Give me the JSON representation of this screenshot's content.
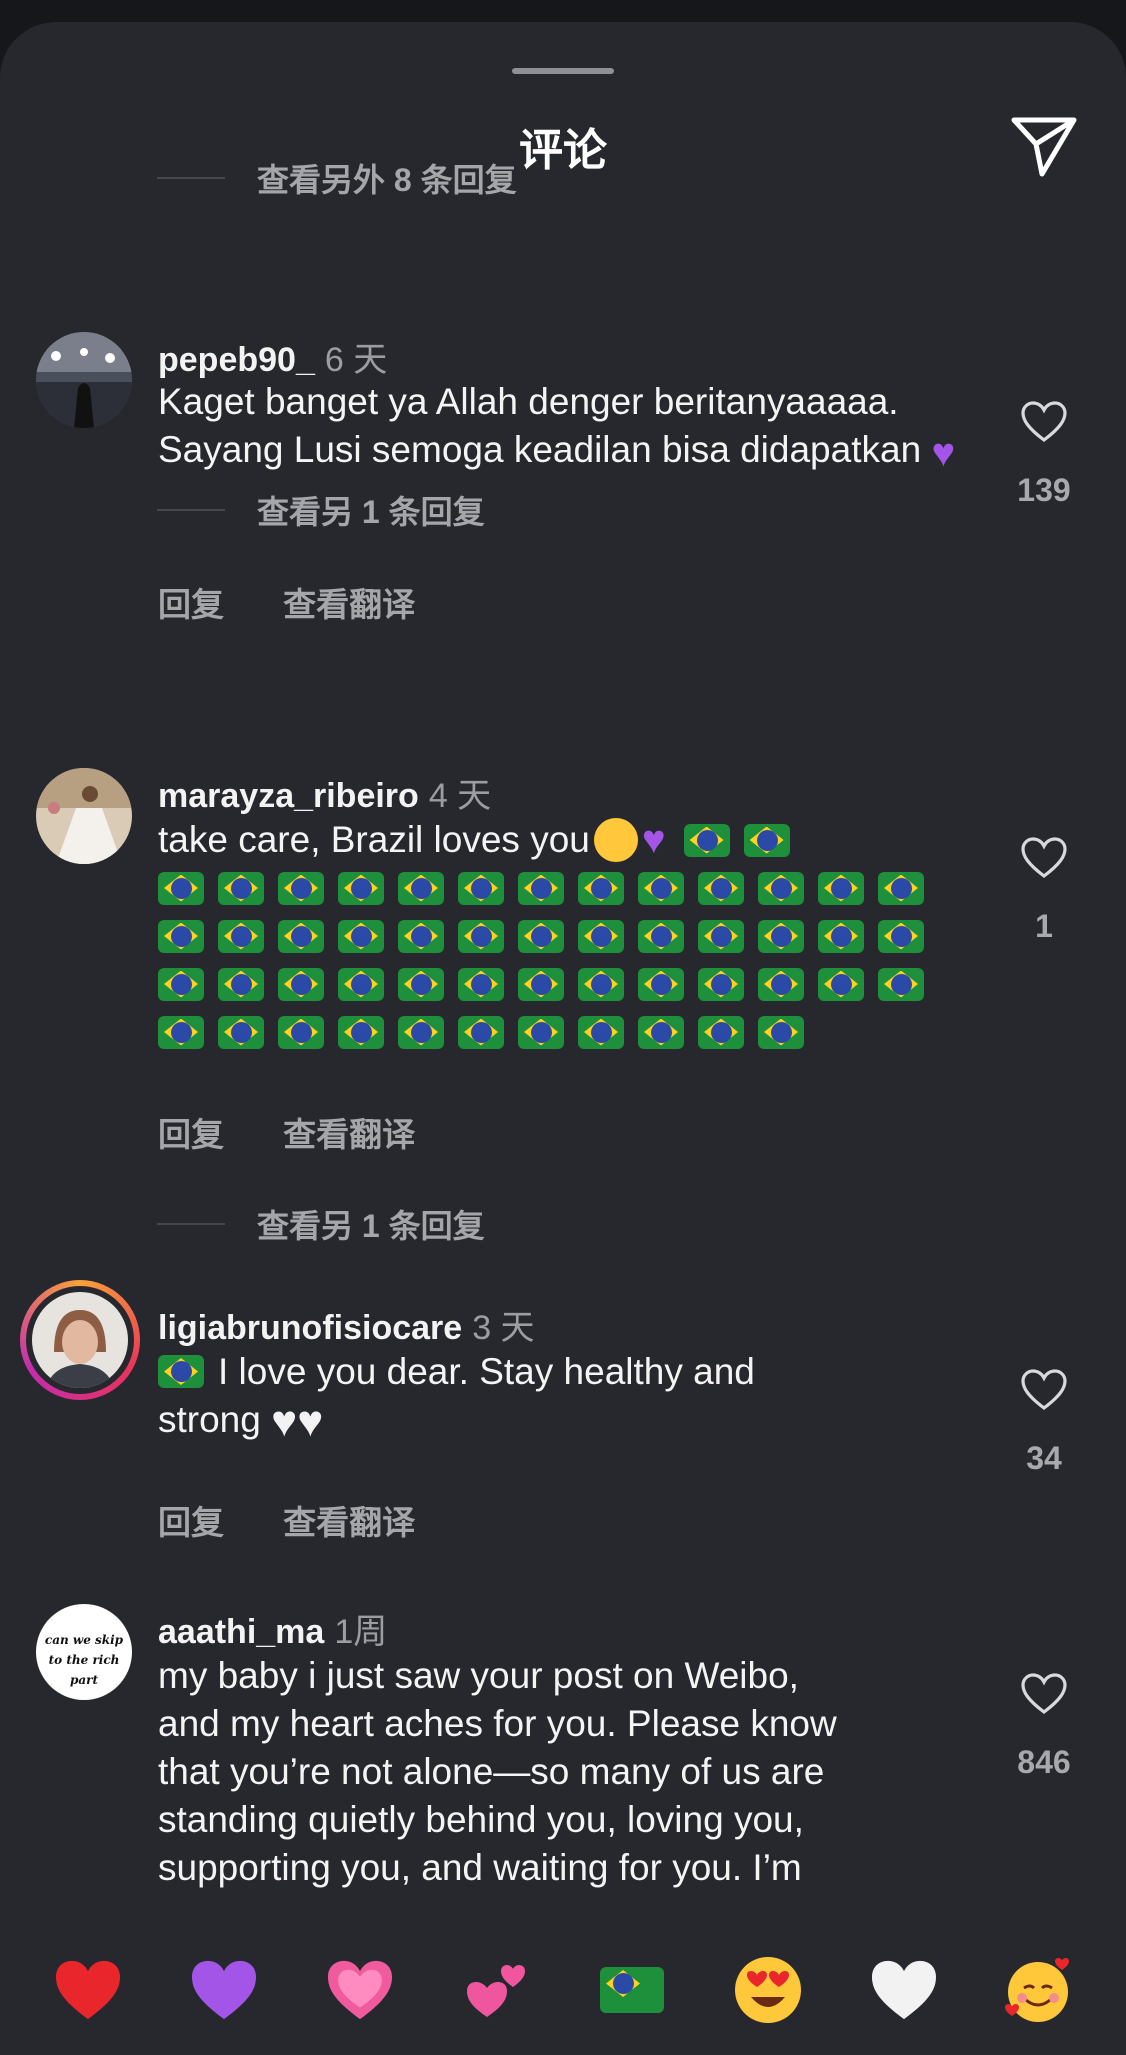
{
  "header": {
    "title": "评论",
    "share_icon": "send-icon"
  },
  "view_more_top": "查看另外 8 条回复",
  "comments": [
    {
      "username": "pepeb90_",
      "time": "6 天",
      "text": "Kaget banget ya Allah denger beritanyaaaaa. Sayang Lusi semoga keadilan bisa didapatkan",
      "emoji_suffix": "purple-heart",
      "reply_label": "回复",
      "translate_label": "查看翻译",
      "likes": "139",
      "more_replies": "查看另 1 条回复"
    },
    {
      "username": "marayza_ribeiro",
      "time": "4 天",
      "text": "take care, Brazil loves you",
      "emoji_suffix": "smiling-face-with-hearts, purple-heart, 48 brazil-flag",
      "flag_rows": [
        2,
        13,
        13,
        13,
        11
      ],
      "reply_label": "回复",
      "translate_label": "查看翻译",
      "likes": "1",
      "more_replies": "查看另 1 条回复"
    },
    {
      "username": "ligiabrunofisiocare",
      "time": "3 天",
      "text_line1": "I love you dear. Stay healthy and",
      "text_line2": "strong",
      "emoji_prefix": "brazil-flag",
      "emoji_suffix": "white-heart x2",
      "reply_label": "回复",
      "translate_label": "查看翻译",
      "likes": "34"
    },
    {
      "username": "aaathi_ma",
      "time": "1周",
      "avatar_text_line1": "can we skip",
      "avatar_text_line2": "to the rich part",
      "text_lines": [
        "my baby i just saw your post on Weibo,",
        "and my heart aches for you. Please know",
        "that you’re not alone—so many of us are",
        "standing quietly behind you, loving you,",
        "supporting you, and waiting for you. I’m"
      ],
      "likes": "846"
    }
  ],
  "emoji_bar": [
    {
      "name": "red-heart",
      "glyph": "❤",
      "color": "#e8262c"
    },
    {
      "name": "purple-heart",
      "glyph": "♥",
      "color": "#a355e8"
    },
    {
      "name": "growing-heart",
      "glyph": "♥",
      "color": "#f05b9e"
    },
    {
      "name": "two-hearts",
      "glyph": "♥",
      "color": "#f0569e"
    },
    {
      "name": "brazil-flag"
    },
    {
      "name": "heart-eyes-face"
    },
    {
      "name": "white-heart",
      "glyph": "♥",
      "color": "#f2f2f2"
    },
    {
      "name": "smiling-face-with-hearts"
    }
  ]
}
